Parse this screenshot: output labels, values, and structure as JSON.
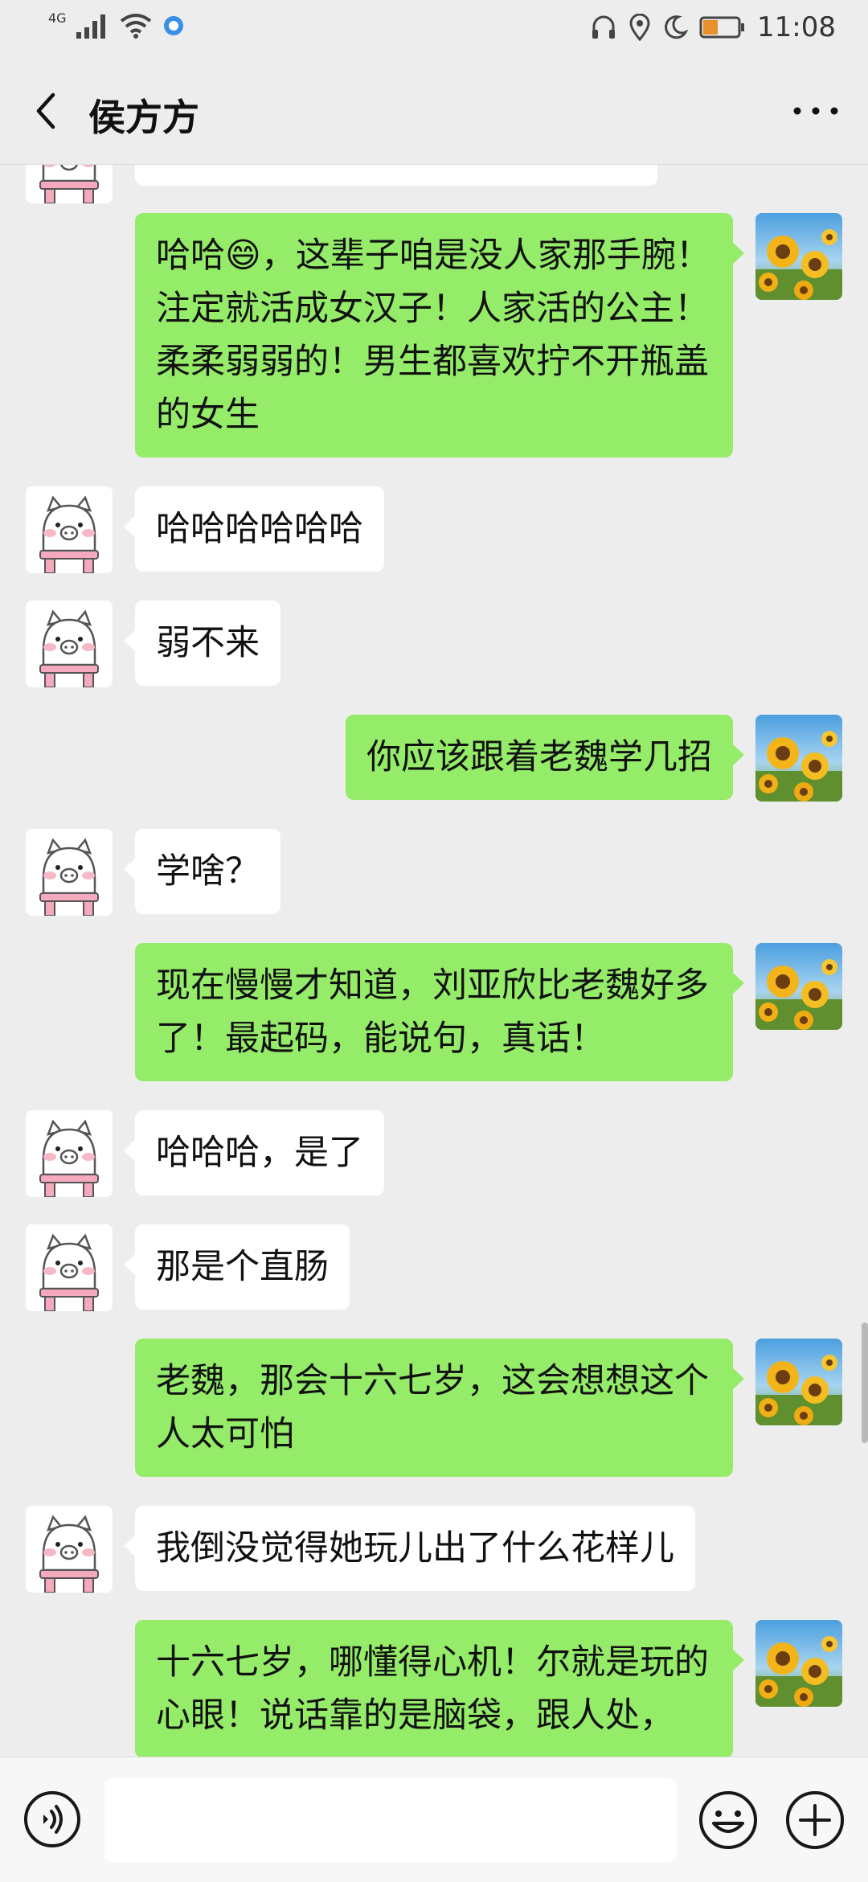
{
  "status_bar": {
    "network": "4G",
    "time": "11:08"
  },
  "header": {
    "contact_name": "侯方方"
  },
  "messages": [
    {
      "side": "left",
      "text": ""
    },
    {
      "side": "right",
      "text": "哈哈😄，这辈子咱是没人家那手腕！注定就活成女汉子！人家活的公主！柔柔弱弱的！男生都喜欢拧不开瓶盖的女生"
    },
    {
      "side": "left",
      "text": "哈哈哈哈哈哈"
    },
    {
      "side": "left",
      "text": "弱不来"
    },
    {
      "side": "right",
      "text": "你应该跟着老魏学几招"
    },
    {
      "side": "left",
      "text": "学啥？"
    },
    {
      "side": "right",
      "text": "现在慢慢才知道，刘亚欣比老魏好多了！最起码，能说句，真话！"
    },
    {
      "side": "left",
      "text": "哈哈哈，是了"
    },
    {
      "side": "left",
      "text": "那是个直肠"
    },
    {
      "side": "right",
      "text": "老魏，那会十六七岁，这会想想这个人太可怕"
    },
    {
      "side": "left",
      "text": "我倒没觉得她玩儿出了什么花样儿"
    },
    {
      "side": "right",
      "text": "十六七岁，哪懂得心机！尔就是玩的心眼！说话靠的是脑袋，跟人处，"
    }
  ],
  "input": {
    "placeholder": ""
  },
  "colors": {
    "background": "#ededed",
    "sent_bubble": "#95ec69",
    "received_bubble": "#ffffff"
  },
  "icons": {
    "back": "chevron-left-icon",
    "more": "more-dots-icon",
    "voice": "voice-icon",
    "emoji": "emoji-icon",
    "plus": "plus-icon"
  }
}
